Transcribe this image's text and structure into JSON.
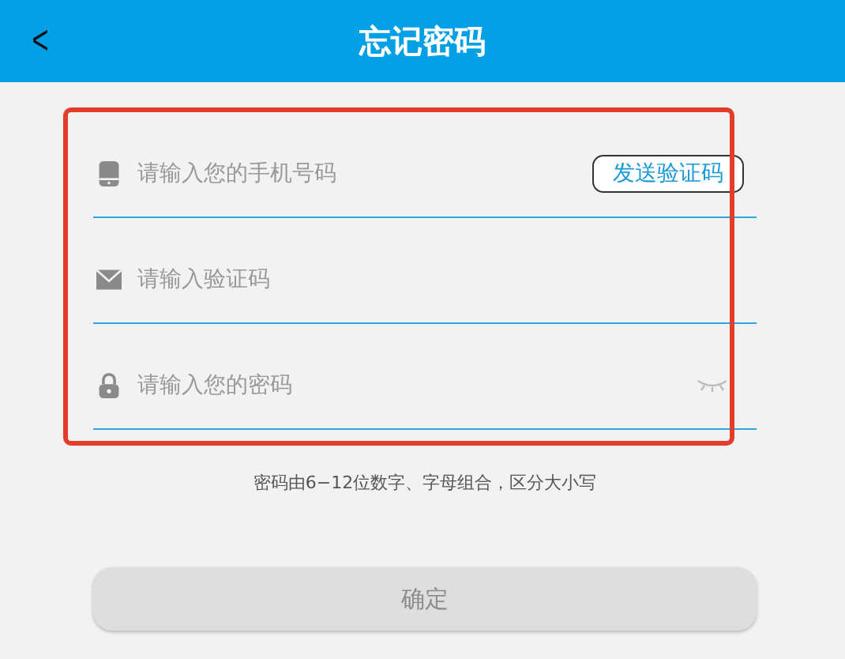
{
  "header": {
    "back": "<",
    "title": "忘记密码"
  },
  "fields": [
    {
      "kind": "phone",
      "placeholder": "请输入您的手机号码",
      "action": "发送验证码"
    },
    {
      "kind": "email",
      "placeholder": "请输入验证码"
    },
    {
      "kind": "password",
      "placeholder": "请输入您的密码",
      "visible": false
    }
  ],
  "hint": "密码由6−12位数字、字母组合，区分大小写",
  "submit": {
    "label": "确定",
    "disabled": true
  }
}
